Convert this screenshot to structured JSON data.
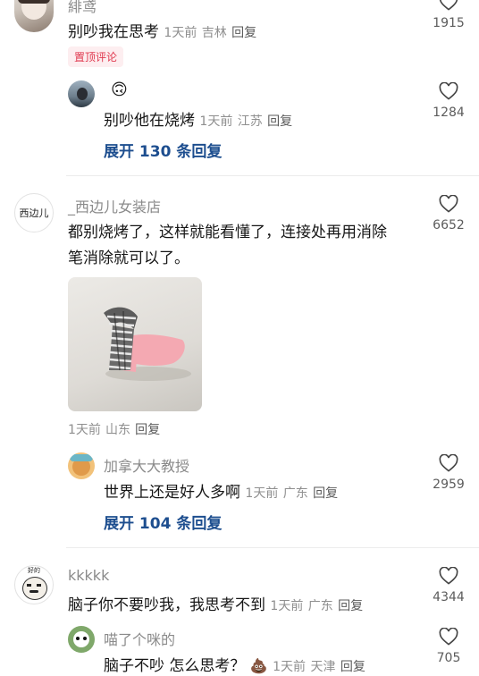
{
  "comments": [
    {
      "user": "緋鸢",
      "text": "别吵我在思考",
      "time": "1天前",
      "location": "吉林",
      "reply": "回复",
      "likes": "1915",
      "pinned": "置顶评论",
      "replies": [
        {
          "user": "",
          "emoji": "🙃",
          "text": "别吵他在烧烤",
          "time": "1天前",
          "location": "江苏",
          "reply": "回复",
          "likes": "1284"
        }
      ],
      "expand": "展开 130 条回复"
    },
    {
      "user": "_西边儿女装店",
      "avatar_text": "西边儿",
      "text_lines": [
        "都别烧烤了，这样就能看懂了，连接处再用消除",
        "笔消除就可以了。"
      ],
      "time": "1天前",
      "location": "山东",
      "reply": "回复",
      "likes": "6652",
      "replies": [
        {
          "user": "加拿大大教授",
          "text": "世界上还是好人多啊",
          "time": "1天前",
          "location": "广东",
          "reply": "回复",
          "likes": "2959"
        }
      ],
      "expand": "展开 104 条回复"
    },
    {
      "user": "kkkkk",
      "avatar_text": "好的",
      "text": "脑子你不要吵我，我思考不到",
      "time": "1天前",
      "location": "广东",
      "reply": "回复",
      "likes": "4344",
      "replies": [
        {
          "user": "喵了个咪的",
          "text": "脑子不吵 怎么思考？",
          "emoji": "💩",
          "time": "1天前",
          "location": "天津",
          "reply": "回复",
          "likes": "705"
        }
      ]
    }
  ],
  "icons": {
    "like": "heart-outline-icon"
  },
  "colors": {
    "expand": "#1d4e8f",
    "pinned": "#e0384e",
    "pinned_bg": "#fdeef0"
  }
}
